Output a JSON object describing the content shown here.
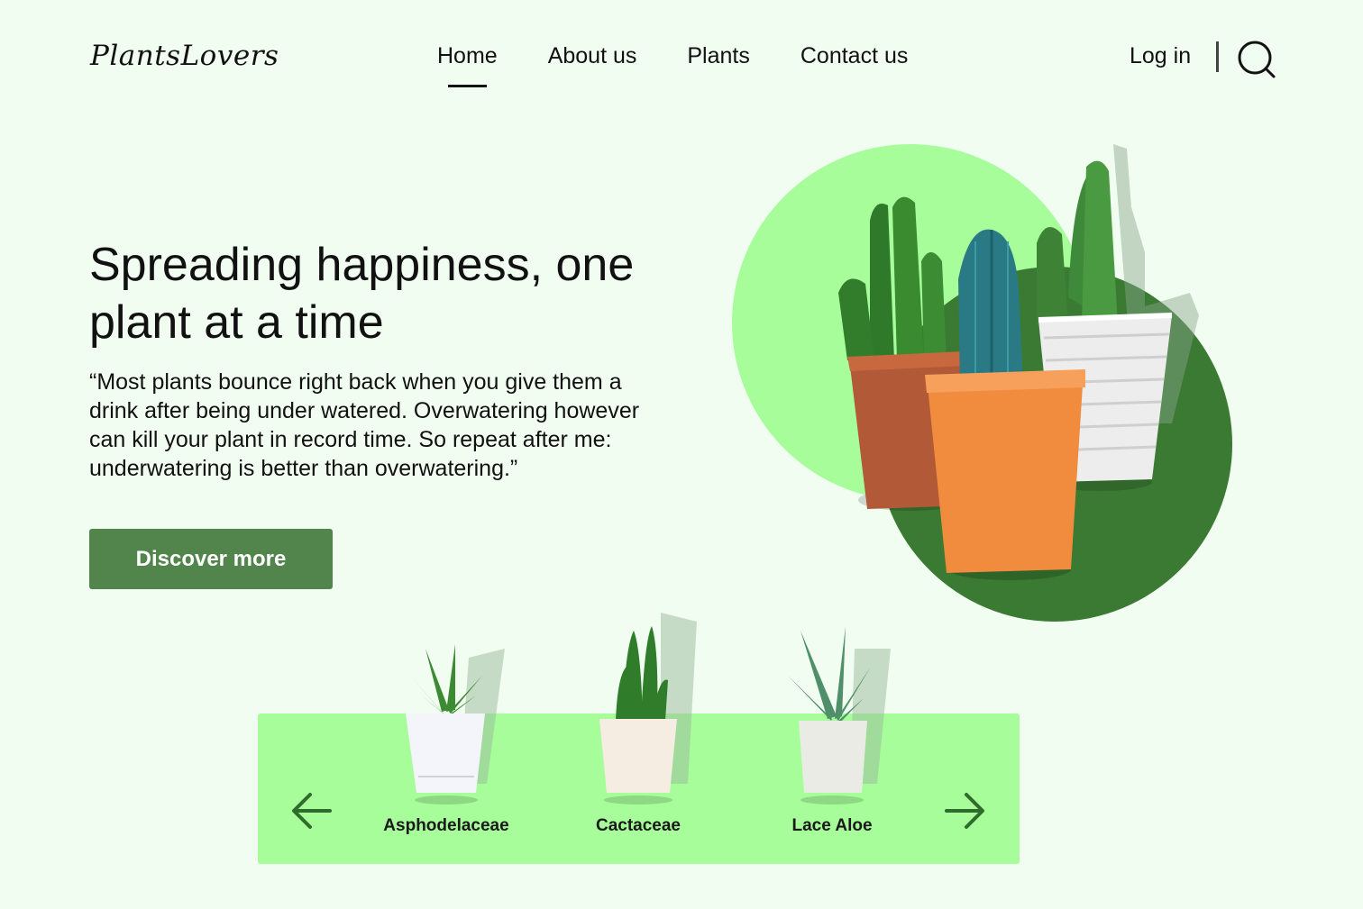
{
  "brand": {
    "logo": "PlantsLovers"
  },
  "nav": {
    "items": [
      {
        "label": "Home",
        "active": true
      },
      {
        "label": "About us",
        "active": false
      },
      {
        "label": "Plants",
        "active": false
      },
      {
        "label": "Contact us",
        "active": false
      }
    ]
  },
  "header": {
    "login_label": "Log in",
    "search_icon": "search-icon"
  },
  "hero": {
    "title": "Spreading happiness, one plant at a time",
    "quote": "“Most plants bounce right back when you give them a drink after being under watered. Overwatering however can kill your plant in record time. So repeat after me: underwatering is better than overwatering.”",
    "cta_label": "Discover more"
  },
  "carousel": {
    "prev_icon": "arrow-left-icon",
    "next_icon": "arrow-right-icon",
    "items": [
      {
        "label": "Asphodelaceae"
      },
      {
        "label": "Cactaceae"
      },
      {
        "label": "Lace Aloe"
      }
    ]
  },
  "colors": {
    "background": "#f1fdf1",
    "cta": "#51854b",
    "light_green": "#a7fd9a",
    "dark_green": "#3a7a33"
  }
}
